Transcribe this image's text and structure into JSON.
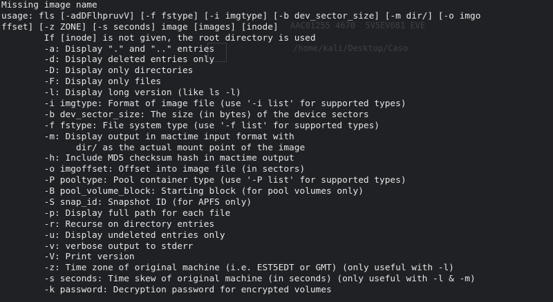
{
  "terminal": {
    "background_color": "#1f2124",
    "text_color": "#e6e6e6",
    "ghost_text": [
      "AAC01255 4670  5V5EV081 EVE",
      "/home/kali/Desktop/Caso"
    ],
    "lines": [
      "Missing image name",
      "usage: fls [-adDFlhpruvV] [-f fstype] [-i imgtype] [-b dev_sector_size] [-m dir/] [-o imgo",
      "ffset] [-z ZONE] [-s seconds] image [images] [inode]",
      "        If [inode] is not given, the root directory is used",
      "        -a: Display \".\" and \"..\" entries",
      "        -d: Display deleted entries only",
      "        -D: Display only directories",
      "        -F: Display only files",
      "        -l: Display long version (like ls -l)",
      "        -i imgtype: Format of image file (use '-i list' for supported types)",
      "        -b dev_sector_size: The size (in bytes) of the device sectors",
      "        -f fstype: File system type (use '-f list' for supported types)",
      "        -m: Display output in mactime input format with",
      "              dir/ as the actual mount point of the image",
      "        -h: Include MD5 checksum hash in mactime output",
      "        -o imgoffset: Offset into image file (in sectors)",
      "        -P pooltype: Pool container type (use '-P list' for supported types)",
      "        -B pool_volume_block: Starting block (for pool volumes only)",
      "        -S snap_id: Snapshot ID (for APFS only)",
      "        -p: Display full path for each file",
      "        -r: Recurse on directory entries",
      "        -u: Display undeleted entries only",
      "        -v: verbose output to stderr",
      "        -V: Print version",
      "        -z: Time zone of original machine (i.e. EST5EDT or GMT) (only useful with -l)",
      "        -s seconds: Time skew of original machine (in seconds) (only useful with -l & -m)",
      "        -k password: Decryption password for encrypted volumes"
    ]
  }
}
